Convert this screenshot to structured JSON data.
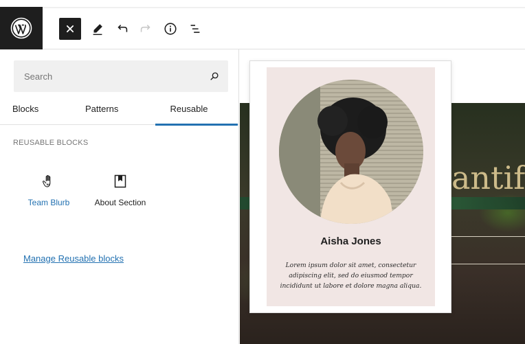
{
  "toolbar": {
    "logo_icon": "wordpress-logo",
    "buttons": [
      {
        "name": "close",
        "icon": "close-icon"
      },
      {
        "name": "tools",
        "icon": "pencil-icon"
      },
      {
        "name": "undo",
        "icon": "undo-icon"
      },
      {
        "name": "redo",
        "icon": "redo-icon"
      },
      {
        "name": "details",
        "icon": "info-icon"
      },
      {
        "name": "list-view",
        "icon": "list-view-icon"
      }
    ]
  },
  "inserter": {
    "search": {
      "placeholder": "Search",
      "value": ""
    },
    "tabs": [
      {
        "label": "Blocks",
        "active": false
      },
      {
        "label": "Patterns",
        "active": false
      },
      {
        "label": "Reusable",
        "active": true
      }
    ],
    "section_title": "REUSABLE BLOCKS",
    "items": [
      {
        "label": "Team Blurb",
        "icon": "hand-pointer-icon"
      },
      {
        "label": "About Section",
        "icon": "bookmark-icon"
      }
    ],
    "manage_link": "Manage Reusable blocks"
  },
  "canvas": {
    "heading_fragment": "antif"
  },
  "preview": {
    "name": "Aisha Jones",
    "bio": "Lorem ipsum dolor sit amet, consectetur adipiscing elit, sed do eiusmod tempor incididunt ut labore et dolore magna aliqua."
  },
  "colors": {
    "accent": "#2271b1",
    "dark": "#1e1e1e",
    "card_bg": "#f1e6e4"
  }
}
